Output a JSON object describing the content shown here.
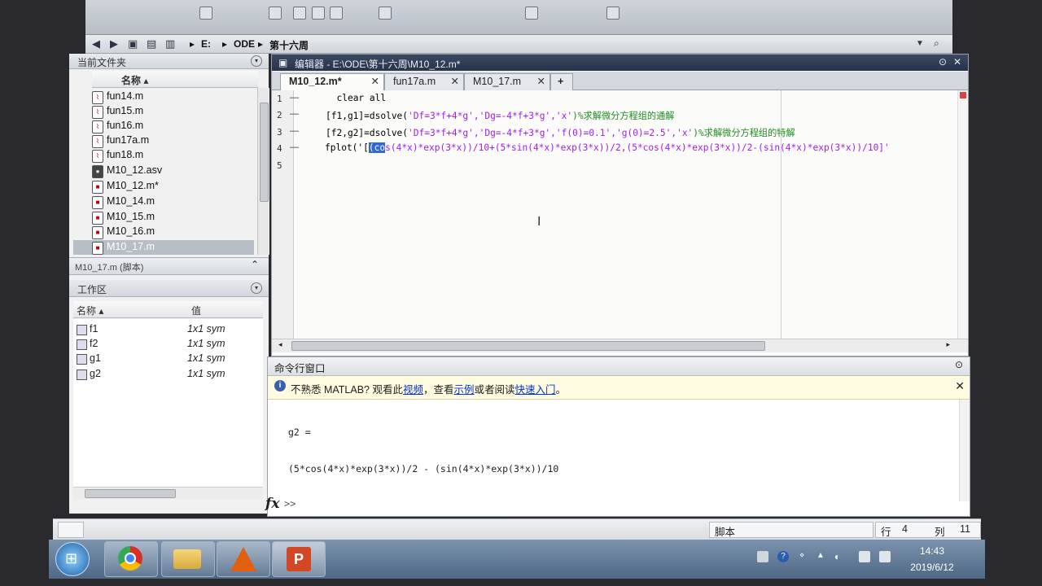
{
  "address": {
    "items": [
      "E:",
      "ODE",
      "第十六周"
    ]
  },
  "current_folder": {
    "title": "当前文件夹",
    "column": "名称 ▴",
    "files": [
      {
        "name": "fun14.m",
        "type": "m"
      },
      {
        "name": "fun15.m",
        "type": "m"
      },
      {
        "name": "fun16.m",
        "type": "m"
      },
      {
        "name": "fun17a.m",
        "type": "m"
      },
      {
        "name": "fun18.m",
        "type": "m"
      },
      {
        "name": "M10_12.asv",
        "type": "asv"
      },
      {
        "name": "M10_12.m*",
        "type": "m"
      },
      {
        "name": "M10_14.m",
        "type": "m"
      },
      {
        "name": "M10_15.m",
        "type": "m"
      },
      {
        "name": "M10_16.m",
        "type": "m"
      },
      {
        "name": "M10_17.m",
        "type": "m",
        "selected": true
      }
    ],
    "details": "M10_17.m  (脚本)"
  },
  "workspace": {
    "title": "工作区",
    "col_name": "名称 ▴",
    "col_value": "值",
    "vars": [
      {
        "name": "f1",
        "value": "1x1 sym"
      },
      {
        "name": "f2",
        "value": "1x1 sym"
      },
      {
        "name": "g1",
        "value": "1x1 sym"
      },
      {
        "name": "g2",
        "value": "1x1 sym"
      }
    ]
  },
  "editor": {
    "title": "编辑器 - E:\\ODE\\第十六周\\M10_12.m*",
    "tabs": [
      {
        "label": "M10_12.m*",
        "active": true
      },
      {
        "label": "fun17a.m",
        "active": false
      },
      {
        "label": "M10_17.m",
        "active": false
      }
    ],
    "add_tab": "+",
    "line_numbers": [
      "1",
      "2",
      "3",
      "4",
      "5"
    ]
  },
  "command_window": {
    "title": "命令行窗口",
    "info_prefix": "不熟悉 MATLAB? 观看此",
    "info_link1": "视频",
    "info_mid1": "，查看",
    "info_link2": "示例",
    "info_mid2": "或者阅读",
    "info_link3": "快速入门",
    "info_suffix": "。",
    "output_var": "g2 =",
    "output_expr": "(5*cos(4*x)*exp(3*x))/2 - (sin(4*x)*exp(3*x))/10",
    "prompt": ">>"
  },
  "status_bar": {
    "mode": "脚本",
    "row_label": "行",
    "row": "4",
    "col_label": "列",
    "col": "11"
  },
  "taskbar": {
    "time": "14:43",
    "date": "2019/6/12"
  }
}
